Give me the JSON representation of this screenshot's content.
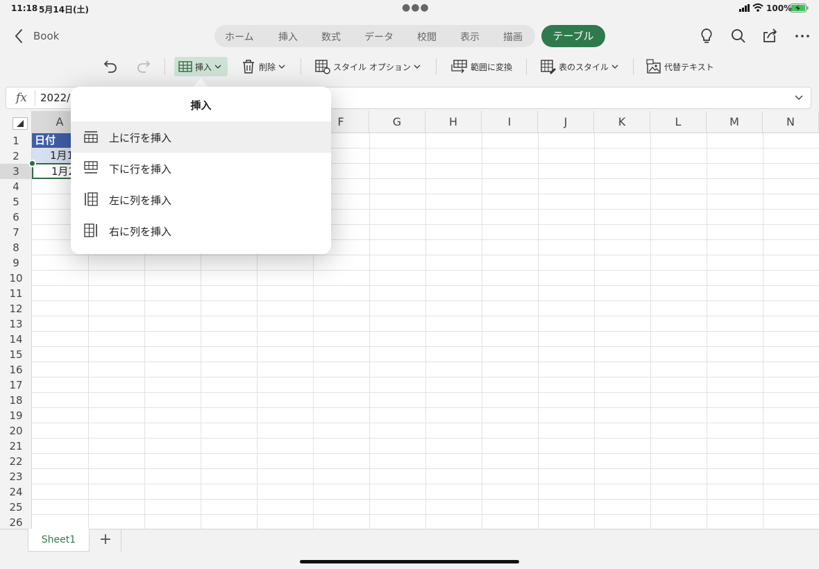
{
  "status": {
    "time": "11:18",
    "date": "5月14日(土)",
    "battery": "100%"
  },
  "header": {
    "title": "Book",
    "tabs": [
      "ホーム",
      "挿入",
      "数式",
      "データ",
      "校閲",
      "表示",
      "描画"
    ],
    "active_tab": "テーブル"
  },
  "toolbar": {
    "insert": "挿入",
    "delete": "削除",
    "style_options": "スタイル オプション",
    "convert_range": "範囲に変換",
    "table_style": "表のスタイル",
    "alt_text": "代替テキスト"
  },
  "formula_bar": {
    "fx": "fx",
    "value": "2022/"
  },
  "grid": {
    "columns": [
      "A",
      "F",
      "G",
      "H",
      "I",
      "J",
      "K",
      "L",
      "M",
      "N"
    ],
    "rows": [
      "1",
      "2",
      "3",
      "4",
      "5",
      "6",
      "7",
      "8",
      "9",
      "10",
      "11",
      "12",
      "13",
      "14",
      "15",
      "16",
      "17",
      "18",
      "19",
      "20",
      "21",
      "22",
      "23",
      "24",
      "25",
      "26"
    ],
    "cells": {
      "a1": "日付",
      "a2": "1月1",
      "a3": "1月2"
    }
  },
  "popup": {
    "title": "挿入",
    "items": [
      "上に行を挿入",
      "下に行を挿入",
      "左に列を挿入",
      "右に列を挿入"
    ]
  },
  "sheets": {
    "active": "Sheet1",
    "add": "+"
  },
  "colors": {
    "accent": "#2f7a4d",
    "table_header": "#3f5fa8",
    "table_band": "#d6e0f1"
  }
}
